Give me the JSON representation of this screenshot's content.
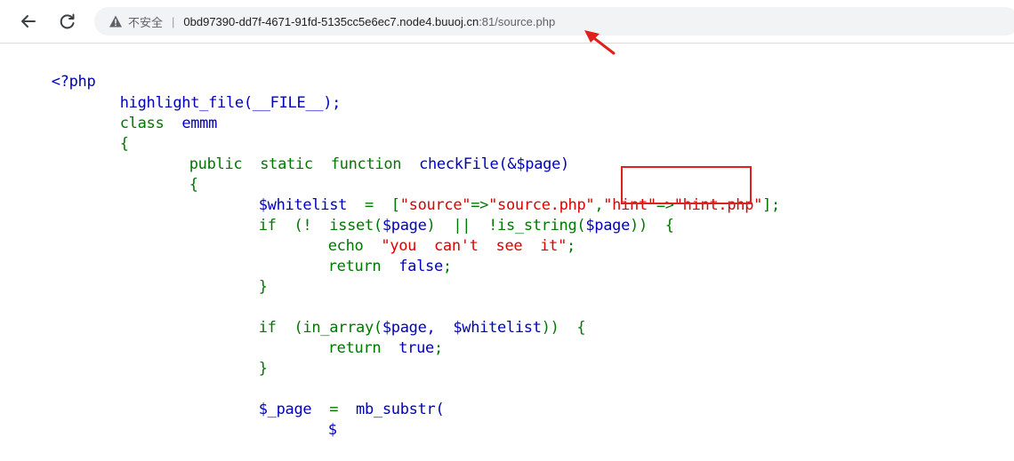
{
  "browser": {
    "security_label": "不安全",
    "separator": "|",
    "url_host": "0bd97390-dd7f-4671-91fd-5135cc5e6ec7.node4.buuoj.cn",
    "url_rest": ":81/source.php",
    "icons": {
      "back": "back-arrow-icon",
      "reload": "reload-icon",
      "warning": "warning-triangle-icon"
    }
  },
  "code": {
    "l1": "<?php",
    "l2_fn": "highlight_file(__FILE__);",
    "l3_kw": "class",
    "l3_name": "emmm",
    "l4": "{",
    "l5_mods": "public  static  function",
    "l5_sig": "checkFile(&$page)",
    "l6": "{",
    "l7_var": "$whitelist",
    "l7_op": "=  [",
    "l7_s1": "\"source\"",
    "l7_arrow1": "=>",
    "l7_s2": "\"source.php\"",
    "l7_comma": ",",
    "l7_s3": "\"hint\"",
    "l7_arrow2": "=>",
    "l7_s4": "\"hint.php\"",
    "l7_end": "];",
    "l8_if": "if  (!  isset(",
    "l8_page1": "$page",
    "l8_mid": ")  ||  !is_string(",
    "l8_page2": "$page",
    "l8_end": "))  {",
    "l9_echo": "echo",
    "l9_str": "\"you  can't  see  it\"",
    "l9_semi": ";",
    "l10_return": "return",
    "l10_val": "false",
    "l10_semi": ";",
    "l11": "}",
    "l13_if": "if  (in_array(",
    "l13_page": "$page,",
    "l13_wl": "$whitelist",
    "l13_end": "))  {",
    "l14_return": "return",
    "l14_val": "true",
    "l14_semi": ";",
    "l15": "}",
    "l17_var": "$_page",
    "l17_op": "=",
    "l17_fn": "mb_substr(",
    "l18_partial": "$"
  },
  "colors": {
    "keyword": "#007700",
    "variable": "#0000bb",
    "string": "#dd0000",
    "annotation": "#e0201a"
  }
}
